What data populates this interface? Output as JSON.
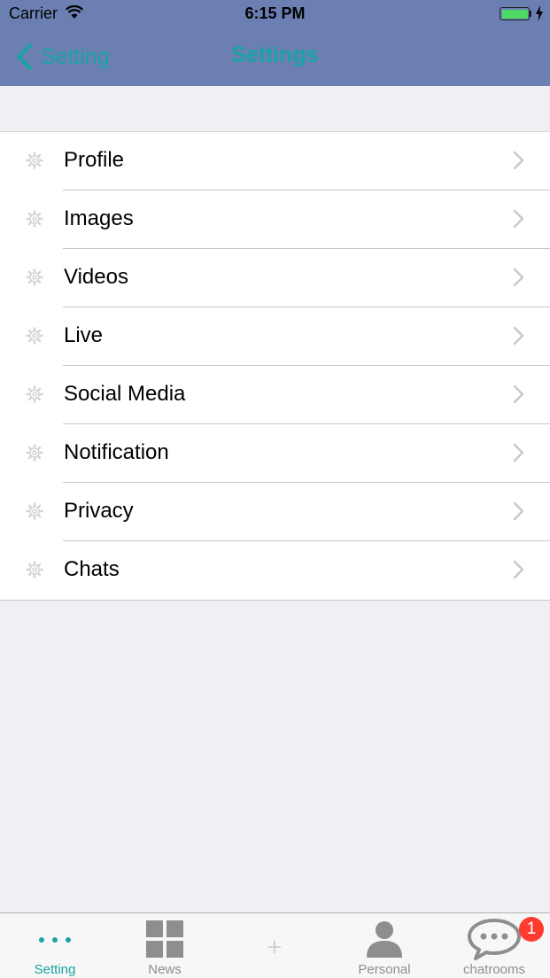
{
  "status_bar": {
    "carrier": "Carrier",
    "time": "6:15 PM"
  },
  "nav": {
    "back_label": "Setting",
    "title": "Settings"
  },
  "settings_items": [
    {
      "label": "Profile",
      "icon": "gear-icon"
    },
    {
      "label": "Images",
      "icon": "gear-icon"
    },
    {
      "label": "Videos",
      "icon": "gear-icon"
    },
    {
      "label": "Live",
      "icon": "gear-icon"
    },
    {
      "label": "Social Media",
      "icon": "gear-icon"
    },
    {
      "label": "Notification",
      "icon": "gear-icon"
    },
    {
      "label": "Privacy",
      "icon": "gear-icon"
    },
    {
      "label": "Chats",
      "icon": "gear-icon"
    }
  ],
  "tabs": [
    {
      "label": "Setting",
      "icon": "more-dots-icon",
      "active": true
    },
    {
      "label": "News",
      "icon": "grid-icon",
      "active": false
    },
    {
      "label": "",
      "icon": "plus-icon",
      "active": false
    },
    {
      "label": "Personal",
      "icon": "person-icon",
      "active": false
    },
    {
      "label": "chatrooms",
      "icon": "chat-bubble-icon",
      "active": false
    }
  ],
  "chatrooms_badge": "1",
  "colors": {
    "nav_background": "#6b7fb2",
    "accent": "#1aa3a3",
    "badge": "#ff3b30",
    "page_background": "#efeff4"
  }
}
